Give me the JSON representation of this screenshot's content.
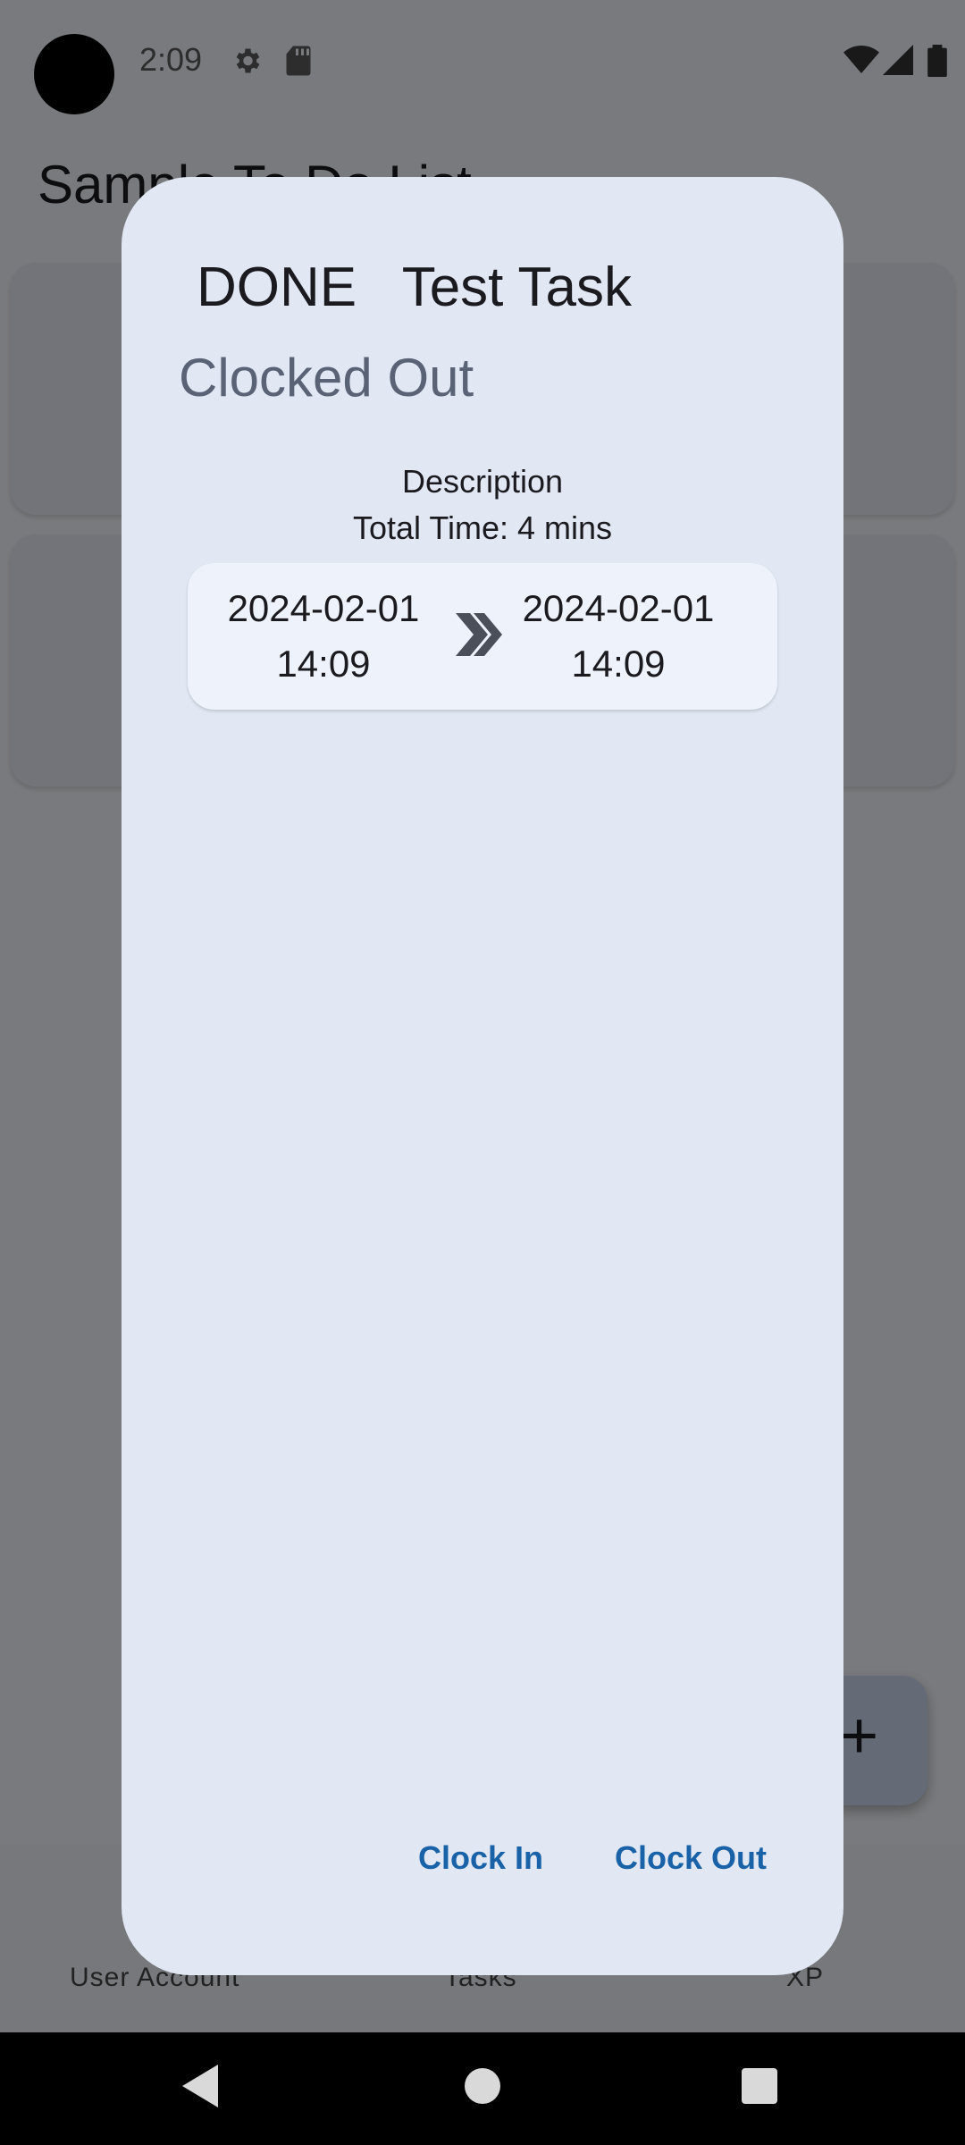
{
  "status_bar": {
    "time": "2:09"
  },
  "app": {
    "title": "Sample To Do List"
  },
  "bottom_nav": {
    "items": [
      {
        "label": "User Account"
      },
      {
        "label": "Tasks"
      },
      {
        "label": "XP"
      }
    ]
  },
  "dialog": {
    "status_tag": "DONE",
    "task_name": "Test Task",
    "clock_state": "Clocked Out",
    "description": "Description",
    "total_time": "Total Time: 4 mins",
    "time_entry": {
      "start_date": "2024-02-01",
      "start_time": "14:09",
      "end_date": "2024-02-01",
      "end_time": "14:09"
    },
    "buttons": {
      "clock_in": "Clock In",
      "clock_out": "Clock Out"
    }
  },
  "colors": {
    "accent": "#1a62a8",
    "dialog_bg": "#e1e8f4",
    "scrim": "#00000080"
  }
}
